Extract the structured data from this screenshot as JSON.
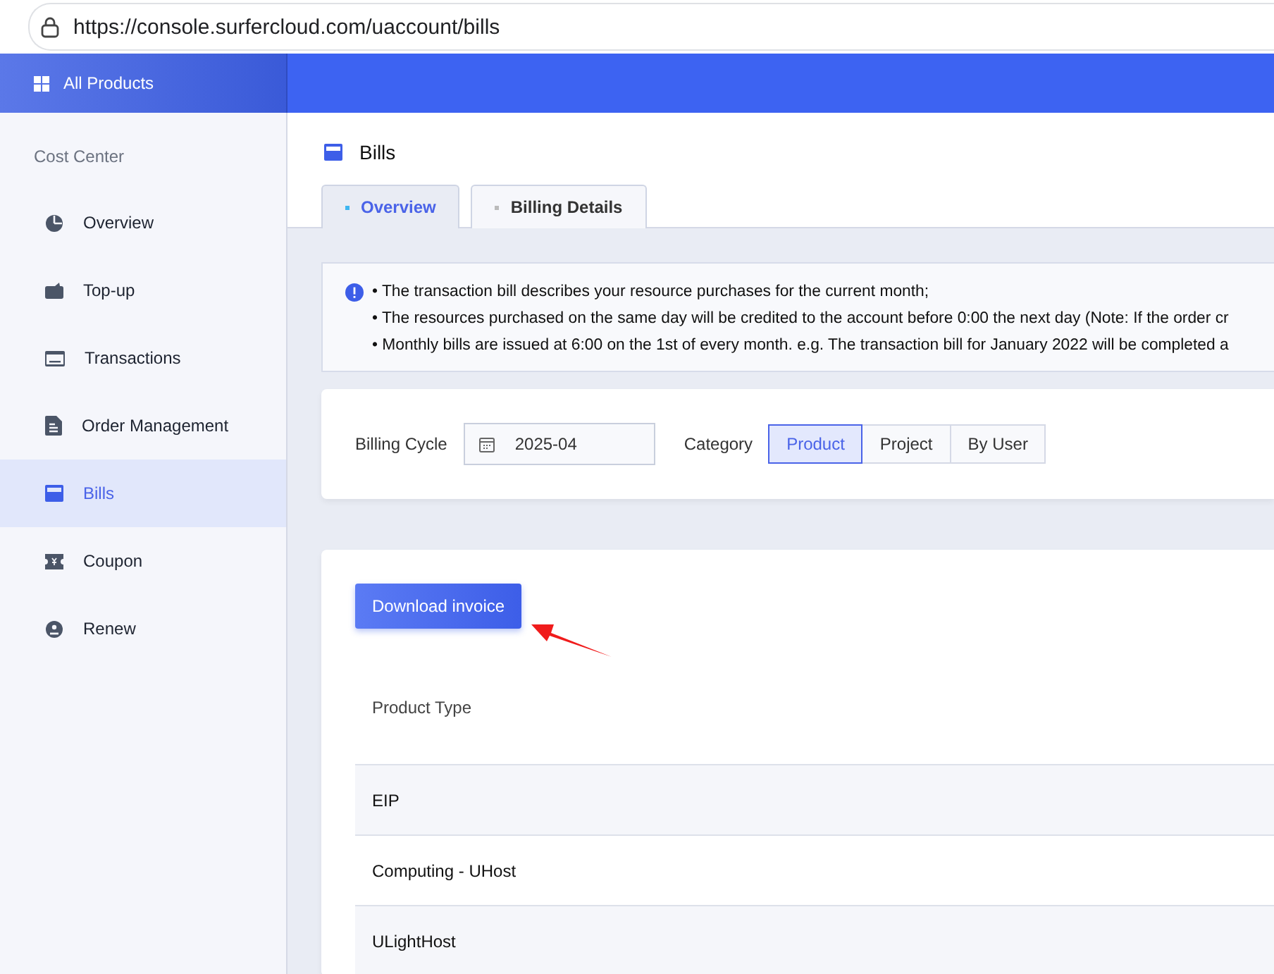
{
  "browser": {
    "url": "https://console.surfercloud.com/uaccount/bills"
  },
  "header": {
    "all_products": "All Products"
  },
  "sidebar": {
    "title": "Cost Center",
    "items": [
      {
        "label": "Overview",
        "selected": false
      },
      {
        "label": "Top-up",
        "selected": false
      },
      {
        "label": "Transactions",
        "selected": false
      },
      {
        "label": "Order Management",
        "selected": false
      },
      {
        "label": "Bills",
        "selected": true
      },
      {
        "label": "Coupon",
        "selected": false
      },
      {
        "label": "Renew",
        "selected": false
      }
    ]
  },
  "page": {
    "title": "Bills",
    "tabs": [
      {
        "label": "Overview",
        "selected": true
      },
      {
        "label": "Billing Details",
        "selected": false
      }
    ]
  },
  "notice": {
    "lines": [
      "• The transaction bill describes your resource purchases for the current month;",
      "• The resources purchased on the same day will be credited to the account before 0:00 the next day (Note: If the order cr",
      "• Monthly bills are issued at 6:00 on the 1st of every month. e.g. The transaction bill for January 2022 will be completed a"
    ]
  },
  "filters": {
    "billing_cycle_label": "Billing Cycle",
    "billing_cycle": "2025-04",
    "category_label": "Category",
    "categories": [
      {
        "label": "Product",
        "selected": true
      },
      {
        "label": "Project",
        "selected": false
      },
      {
        "label": "By User",
        "selected": false
      }
    ]
  },
  "download_button": "Download invoice",
  "table": {
    "columns": [
      "Product Type"
    ],
    "rows": [
      {
        "cells": [
          "EIP"
        ]
      },
      {
        "cells": [
          "Computing - UHost"
        ]
      },
      {
        "cells": [
          "ULightHost"
        ]
      }
    ]
  }
}
